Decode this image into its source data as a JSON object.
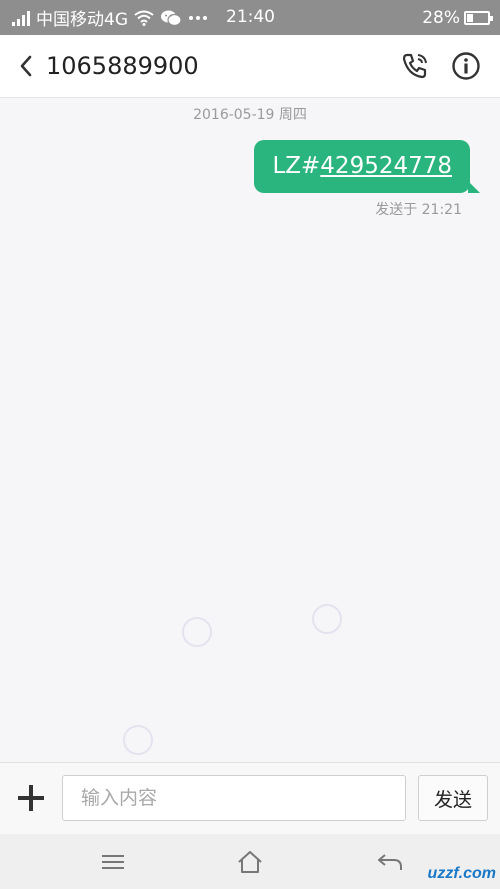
{
  "status_bar": {
    "carrier": "中国移动4G",
    "time": "21:40",
    "battery_percent_label": "28%",
    "battery_level": 0.28
  },
  "header": {
    "contact": "1065889900"
  },
  "conversation": {
    "date_separator": "2016-05-19 周四",
    "messages": [
      {
        "prefix": "LZ#",
        "number": "429524778",
        "sent_label": "发送于 21:21"
      }
    ]
  },
  "composer": {
    "placeholder": "输入内容",
    "value": "",
    "send_label": "发送"
  },
  "watermark": "uzzf.com",
  "colors": {
    "bubble": "#2bb57e",
    "status_bar": "#8e8e8e"
  },
  "icons": {
    "back": "chevron-left-icon",
    "call": "phone-call-icon",
    "info": "info-icon",
    "attach": "plus-icon",
    "menu": "menu-icon",
    "home": "home-icon",
    "back_nav": "back-arrow-icon"
  }
}
